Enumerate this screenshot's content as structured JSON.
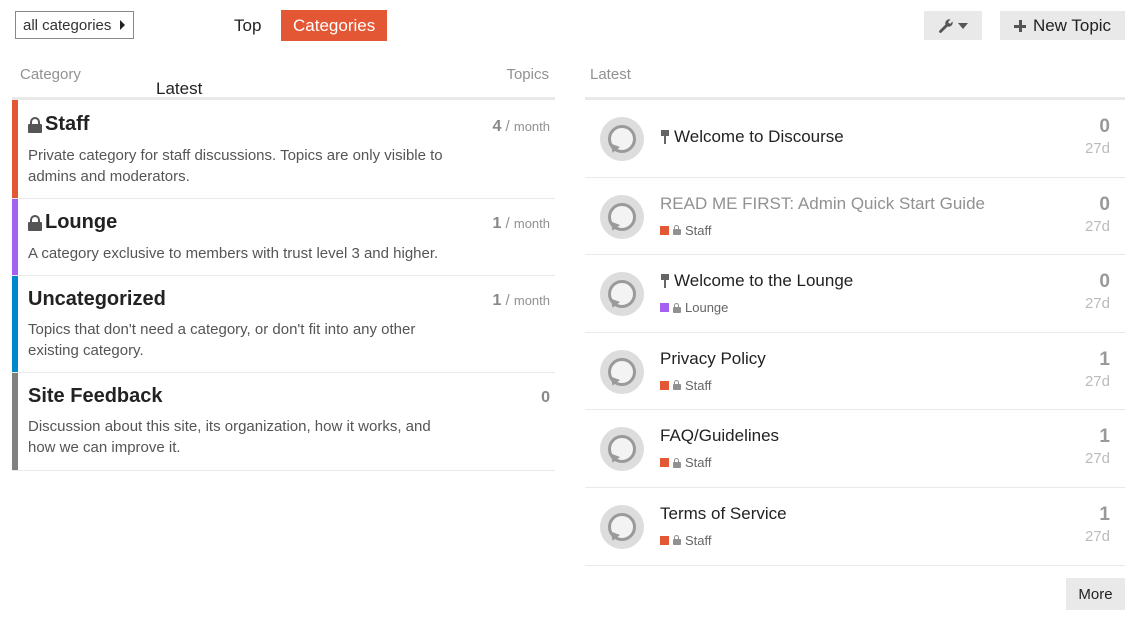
{
  "nav": {
    "category_dropdown": "all categories",
    "tabs": [
      "Latest",
      "Top",
      "Categories"
    ],
    "active_tab": "Categories",
    "new_topic": "New Topic",
    "accent": "#e45735"
  },
  "categories_table": {
    "header_category": "Category",
    "header_topics": "Topics",
    "rows": [
      {
        "name": "Staff",
        "locked": true,
        "color": "#e45735",
        "description": "Private category for staff discussions. Topics are only visible to admins and moderators.",
        "count": "4",
        "sep": "/",
        "period": "month"
      },
      {
        "name": "Lounge",
        "locked": true,
        "color": "#a461ef",
        "description": "A category exclusive to members with trust level 3 and higher.",
        "count": "1",
        "sep": "/",
        "period": "month"
      },
      {
        "name": "Uncategorized",
        "locked": false,
        "color": "#0088cc",
        "description": "Topics that don't need a category, or don't fit into any other existing category.",
        "count": "1",
        "sep": "/",
        "period": "month"
      },
      {
        "name": "Site Feedback",
        "locked": false,
        "color": "#808281",
        "description": "Discussion about this site, its organization, how it works, and how we can improve it.",
        "count": "0",
        "sep": "",
        "period": ""
      }
    ]
  },
  "latest": {
    "header": "Latest",
    "topics": [
      {
        "title": "Welcome to Discourse",
        "pinned": true,
        "visited": false,
        "category": "",
        "cat_color": "",
        "replies": "0",
        "age": "27d"
      },
      {
        "title": "READ ME FIRST: Admin Quick Start Guide",
        "pinned": false,
        "visited": true,
        "category": "Staff",
        "cat_color": "#e45735",
        "replies": "0",
        "age": "27d"
      },
      {
        "title": "Welcome to the Lounge",
        "pinned": true,
        "visited": false,
        "category": "Lounge",
        "cat_color": "#a461ef",
        "replies": "0",
        "age": "27d"
      },
      {
        "title": "Privacy Policy",
        "pinned": false,
        "visited": false,
        "category": "Staff",
        "cat_color": "#e45735",
        "replies": "1",
        "age": "27d"
      },
      {
        "title": "FAQ/Guidelines",
        "pinned": false,
        "visited": false,
        "category": "Staff",
        "cat_color": "#e45735",
        "replies": "1",
        "age": "27d"
      },
      {
        "title": "Terms of Service",
        "pinned": false,
        "visited": false,
        "category": "Staff",
        "cat_color": "#e45735",
        "replies": "1",
        "age": "27d"
      }
    ],
    "more": "More"
  }
}
